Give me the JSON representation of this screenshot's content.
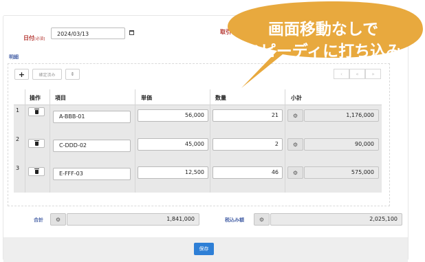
{
  "form": {
    "date_label": "日付",
    "date_required": "[必須]",
    "date_value": "2024/03/13",
    "partial_label": "取引"
  },
  "details_label": "明細",
  "toolbar": {
    "add_label": "+",
    "confirmed_label": "確定済み",
    "sort_label": "⇕",
    "pager": [
      "‹",
      "«",
      "»"
    ]
  },
  "table": {
    "headers": [
      "操作",
      "項目",
      "単価",
      "数量",
      "小計"
    ],
    "rows": [
      {
        "num": "1",
        "item": "A-BBB-01",
        "price": "56,000",
        "qty": "21",
        "subtotal": "1,176,000"
      },
      {
        "num": "2",
        "item": "C-DDD-02",
        "price": "45,000",
        "qty": "2",
        "subtotal": "90,000"
      },
      {
        "num": "3",
        "item": "E-FFF-03",
        "price": "12,500",
        "qty": "46",
        "subtotal": "575,000"
      }
    ]
  },
  "totals": {
    "total_label": "合計",
    "total_value": "1,841,000",
    "taxed_label": "税込み額",
    "taxed_value": "2,025,100"
  },
  "save_label": "保存",
  "callout": {
    "line1": "画面移動なしで",
    "line2": "スピーディに打ち込み",
    "color": "#e8a93e"
  }
}
